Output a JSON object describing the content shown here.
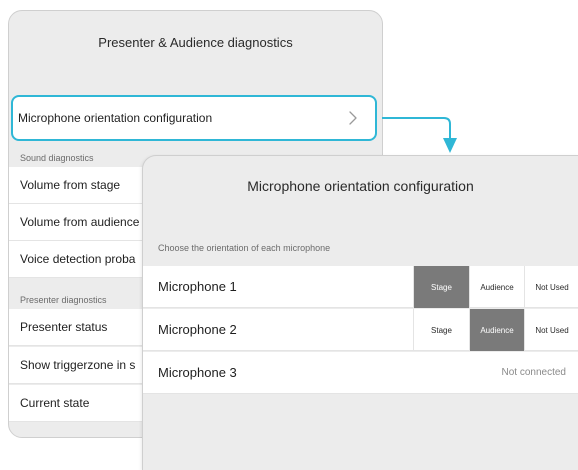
{
  "back_panel": {
    "title": "Presenter & Audience diagnostics",
    "mic_config_row": {
      "label": "Microphone orientation configuration"
    },
    "sound_section_label": "Sound diagnostics",
    "sound_items": [
      {
        "label": "Volume from stage"
      },
      {
        "label": "Volume from audience"
      },
      {
        "label": "Voice detection proba"
      }
    ],
    "presenter_section_label": "Presenter diagnostics",
    "presenter_items": [
      {
        "label": "Presenter status"
      },
      {
        "label": "Show triggerzone in s"
      },
      {
        "label": "Current state"
      }
    ]
  },
  "front_panel": {
    "title": "Microphone orientation configuration",
    "subtitle": "Choose the orientation of each microphone",
    "options": {
      "stage": "Stage",
      "audience": "Audience",
      "not_used": "Not Used"
    },
    "microphones": [
      {
        "label": "Microphone 1",
        "selected": "Stage"
      },
      {
        "label": "Microphone 2",
        "selected": "Audience"
      },
      {
        "label": "Microphone 3",
        "status": "Not connected"
      }
    ]
  },
  "colors": {
    "highlight_accent": "#2fb7d6",
    "selected_segment": "#7a7a7a",
    "panel_background": "#ececec"
  },
  "icons": {
    "row_chevron": "chevron-right-icon",
    "connector": "connector-arrow-icon"
  }
}
